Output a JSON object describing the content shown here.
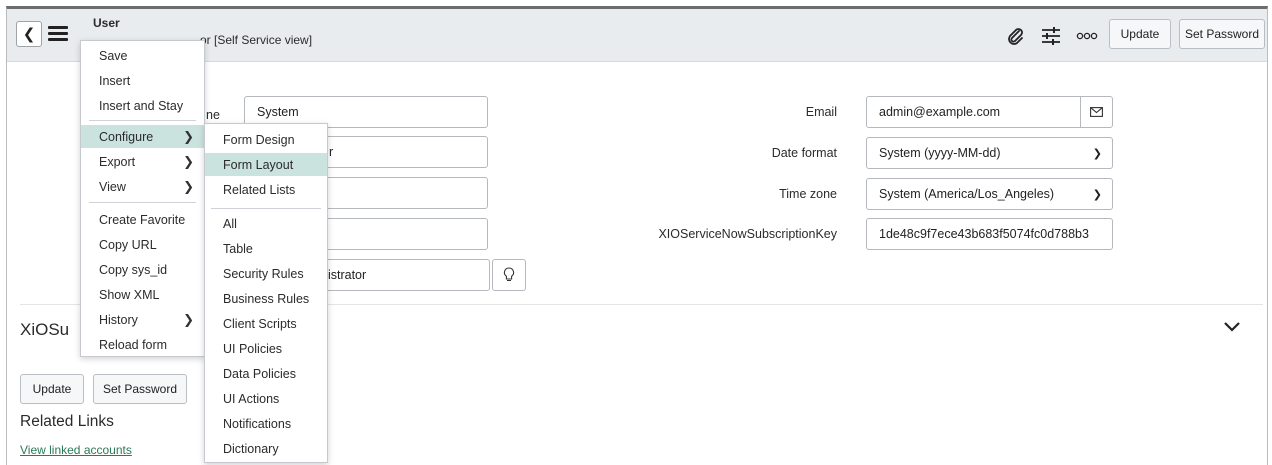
{
  "header": {
    "record_type": "User",
    "record_name": "System Administrator [Self Service view]",
    "record_name_visible": "or [Self Service view]",
    "update_label": "Update",
    "set_password_label": "Set Password"
  },
  "form": {
    "name_label_fragment": "ne",
    "first_name_value": "System",
    "last_name_value_fragment": "r",
    "title_value_fragment": "nistrator",
    "email_label": "Email",
    "email_value": "admin@example.com",
    "date_format_label": "Date format",
    "date_format_value": "System (yyyy-MM-dd)",
    "time_zone_label": "Time zone",
    "time_zone_value": "System (America/Los_Angeles)",
    "subscription_key_label": "XIOServiceNowSubscriptionKey",
    "subscription_key_value": "1de48c9f7ece43b683f5074fc0d788b3"
  },
  "section": {
    "title_fragment": "XiOSu"
  },
  "bottom": {
    "update_label": "Update",
    "set_password_label": "Set Password",
    "related_links_title": "Related Links",
    "view_linked_accounts": "View linked accounts"
  },
  "context_menu": {
    "items": [
      {
        "label": "Save"
      },
      {
        "label": "Insert"
      },
      {
        "label": "Insert and Stay"
      },
      {
        "label": "Configure"
      },
      {
        "label": "Export"
      },
      {
        "label": "View"
      },
      {
        "label": "Create Favorite"
      },
      {
        "label": "Copy URL"
      },
      {
        "label": "Copy sys_id"
      },
      {
        "label": "Show XML"
      },
      {
        "label": "History"
      },
      {
        "label": "Reload form"
      }
    ]
  },
  "configure_submenu": {
    "items": [
      {
        "label": "Form Design"
      },
      {
        "label": "Form Layout"
      },
      {
        "label": "Related Lists"
      },
      {
        "label": "All"
      },
      {
        "label": "Table"
      },
      {
        "label": "Security Rules"
      },
      {
        "label": "Business Rules"
      },
      {
        "label": "Client Scripts"
      },
      {
        "label": "UI Policies"
      },
      {
        "label": "Data Policies"
      },
      {
        "label": "UI Actions"
      },
      {
        "label": "Notifications"
      },
      {
        "label": "Dictionary"
      }
    ]
  },
  "colors": {
    "header_bg": "#e9ecef",
    "menu_highlight": "#cbe3de",
    "link": "#2a7a55"
  }
}
